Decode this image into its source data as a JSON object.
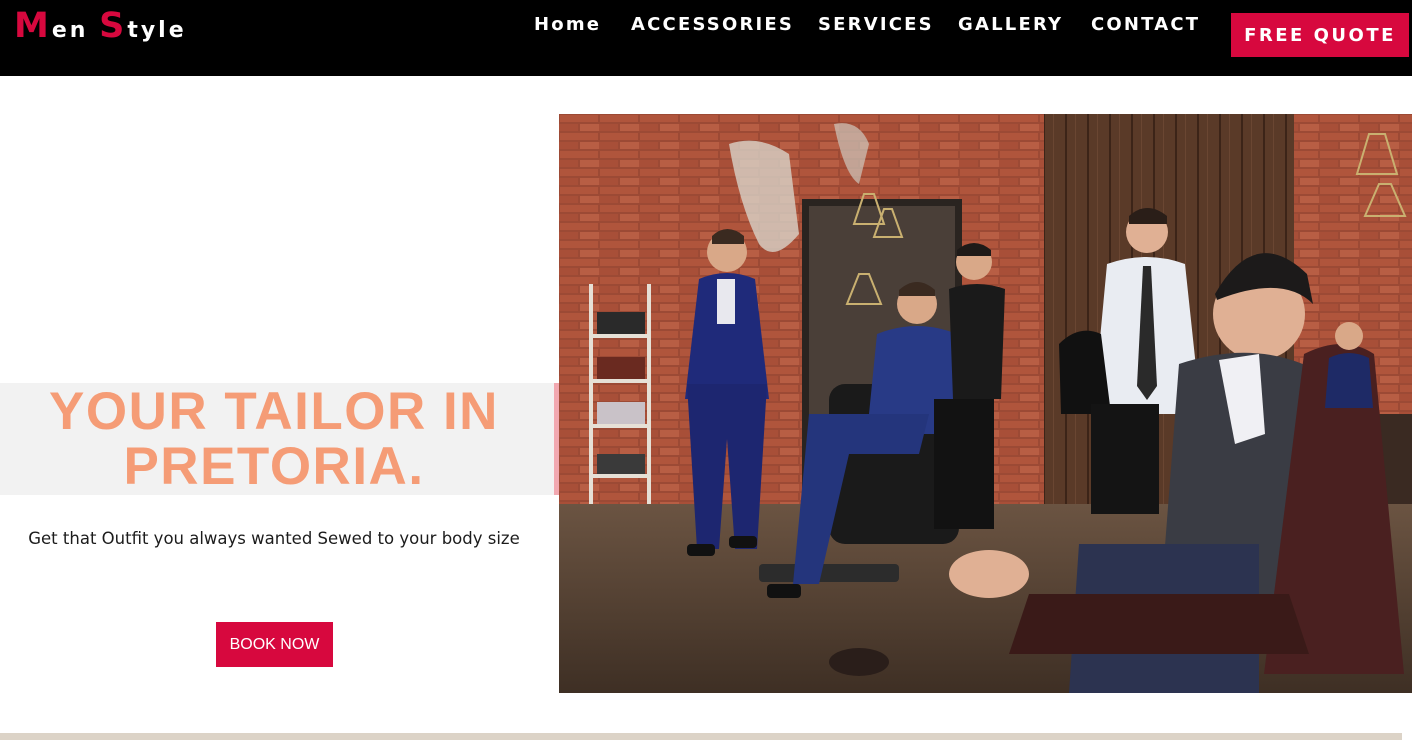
{
  "header": {
    "logo": {
      "letter1": "M",
      "rest1": "en",
      "letter2": "S",
      "rest2": "tyle"
    },
    "nav": [
      "Home",
      "ACCESSORIES",
      "SERVICES",
      "GALLERY",
      "CONTACT"
    ],
    "quote_button": "FREE QUOTE"
  },
  "hero": {
    "headline_line1": "YOUR TAILOR IN",
    "headline_line2": "PRETORIA.",
    "subtitle": "Get that Outfit you always wanted Sewed to your body size",
    "book_button": "BOOK NOW",
    "photo": "barbershop-group-photo"
  },
  "colors": {
    "accent": "#d7083e",
    "headline": "#f59c76",
    "topbar": "#000000",
    "band": "#f2f2f2"
  }
}
